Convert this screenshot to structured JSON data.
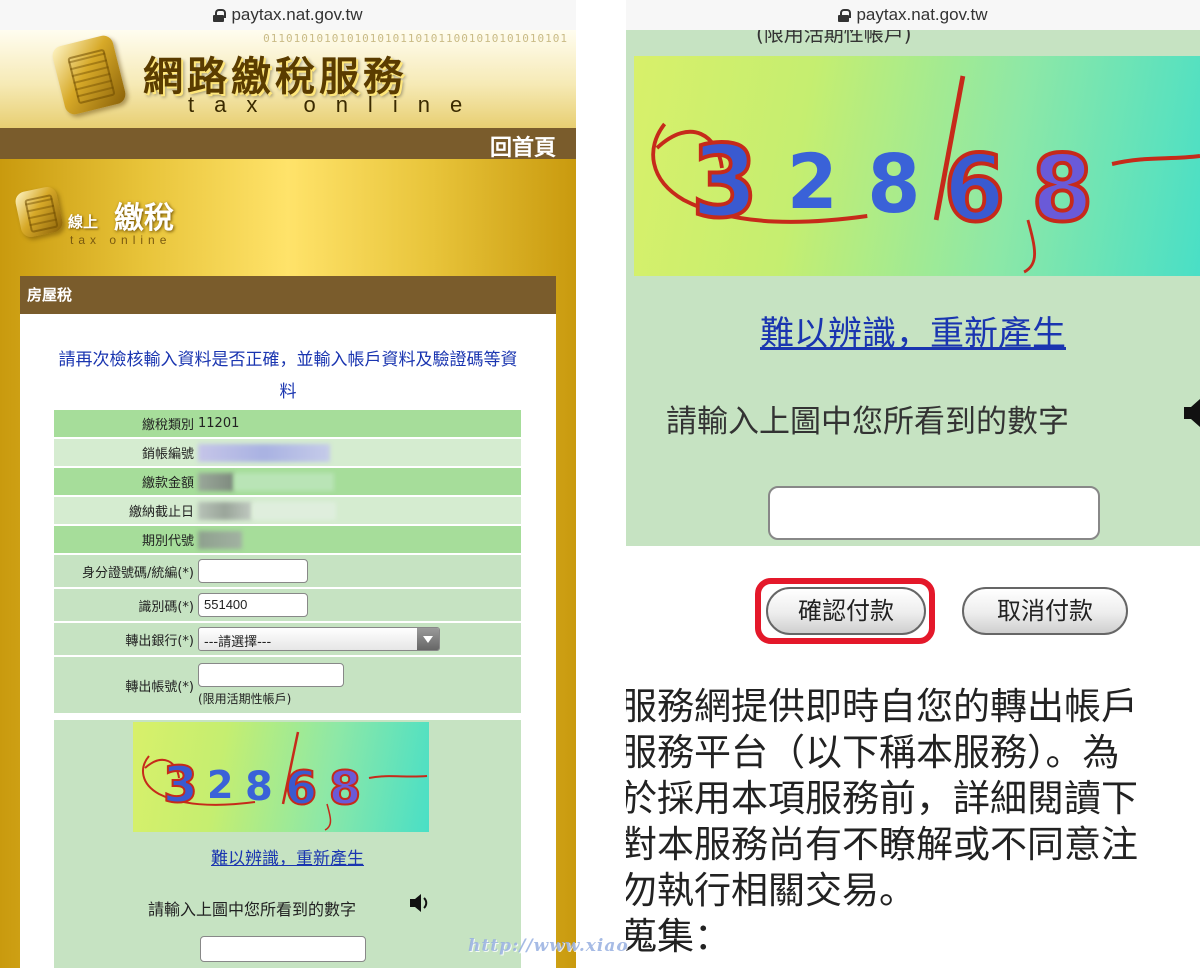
{
  "left": {
    "url": "paytax.nat.gov.tw",
    "banner": {
      "title": "網路繳稅服務",
      "subtitle": "tax online",
      "digits": "0110101010101010101101011001010101010101"
    },
    "home_link": "回首頁",
    "logo2": {
      "small": "線上",
      "big": "繳稅",
      "sub": "tax online"
    },
    "section_title": "房屋稅",
    "intro": "請再次檢核輸入資料是否正確，並輸入帳戶資料及驗證碼等資料",
    "rows": {
      "tax_type": {
        "label": "繳稅類別",
        "value": "11201"
      },
      "bill_no": {
        "label": "銷帳編號"
      },
      "amount": {
        "label": "繳款金額"
      },
      "due_date": {
        "label": "繳納截止日"
      },
      "period_code": {
        "label": "期別代號"
      },
      "id_no": {
        "label": "身分證號碼/統編(*)",
        "value": ""
      },
      "ident_code": {
        "label": "識別碼(*)",
        "value": "551400"
      },
      "bank": {
        "label": "轉出銀行(*)",
        "selected": "---請選擇---"
      },
      "account": {
        "label": "轉出帳號(*)",
        "value": "",
        "note": "(限用活期性帳戶)"
      }
    },
    "captcha": {
      "digits": [
        "3",
        "2",
        "8",
        "6",
        "8"
      ],
      "refresh_label": "難以辨識，重新產生",
      "prompt": "請輸入上圖中您所看到的數字",
      "input_value": ""
    }
  },
  "right": {
    "url": "paytax.nat.gov.tw",
    "cut_text": "(限用活期性帳戶)",
    "refresh_label": "難以辨識，重新產生",
    "prompt": "請輸入上圖中您所看到的數字",
    "input_value": "",
    "confirm_label": "確認付款",
    "cancel_label": "取消付款",
    "terms_lines": [
      "服務網提供即時自您的轉出帳戶",
      "服務平台（以下稱本服務）。為",
      "於採用本項服務前，詳細閱讀下",
      "對本服務尚有不瞭解或不同意注",
      "勿執行相關交易。",
      "蒐集："
    ]
  },
  "watermark": {
    "url": "http://www.xiao"
  },
  "colors": {
    "banner_brown": "#7a5c2c",
    "gold": "#e8c43a",
    "row_highlight": "#a6dd9a",
    "row_plain": "#d5ecd0",
    "row_input": "#c6e3c2",
    "link_blue": "#1a35b0",
    "highlight_red": "#e4182a"
  },
  "icons": [
    "lock-icon",
    "chip-logo-icon",
    "speaker-icon",
    "select-arrow-icon"
  ]
}
